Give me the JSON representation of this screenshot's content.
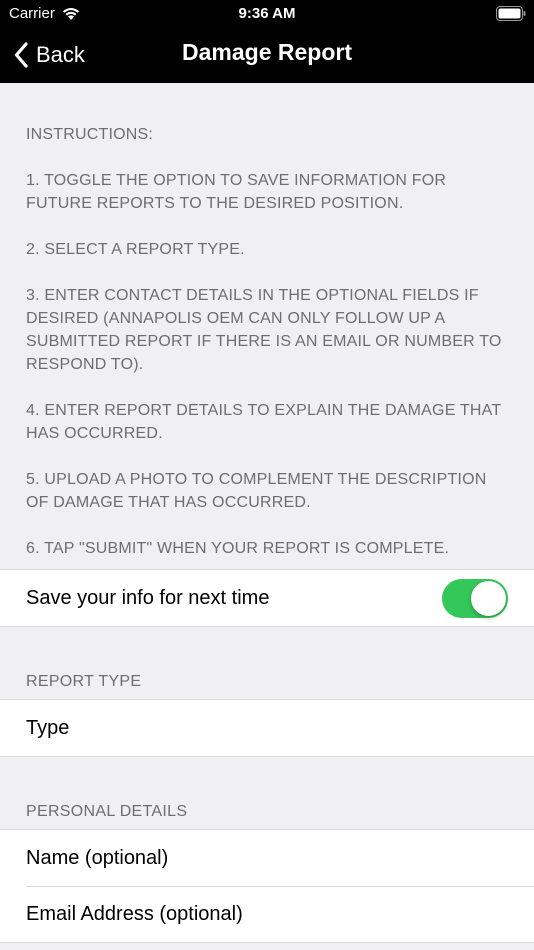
{
  "status_bar": {
    "carrier": "Carrier",
    "time": "9:36 AM"
  },
  "nav": {
    "back_label": "Back",
    "title": "Damage Report"
  },
  "instructions": [
    "INSTRUCTIONS:",
    "1. TOGGLE THE OPTION TO SAVE INFORMATION FOR FUTURE REPORTS TO THE DESIRED POSITION.",
    "2. SELECT A REPORT TYPE.",
    "3. ENTER CONTACT DETAILS IN THE OPTIONAL FIELDS IF DESIRED (ANNAPOLIS OEM CAN ONLY FOLLOW UP A SUBMITTED REPORT IF THERE IS AN EMAIL OR NUMBER TO RESPOND TO).",
    "4. ENTER REPORT DETAILS TO EXPLAIN THE DAMAGE THAT HAS OCCURRED.",
    "5. UPLOAD A PHOTO TO COMPLEMENT THE DESCRIPTION OF DAMAGE THAT HAS OCCURRED.",
    "6. TAP \"SUBMIT\" WHEN YOUR REPORT IS COMPLETE."
  ],
  "save_info": {
    "label": "Save your info for next time",
    "enabled": true,
    "toggle_color": "#34c759"
  },
  "report_type": {
    "header": "REPORT TYPE",
    "placeholder": "Type"
  },
  "personal_details": {
    "header": "PERSONAL DETAILS",
    "name_placeholder": "Name (optional)",
    "email_placeholder": "Email Address (optional)"
  }
}
